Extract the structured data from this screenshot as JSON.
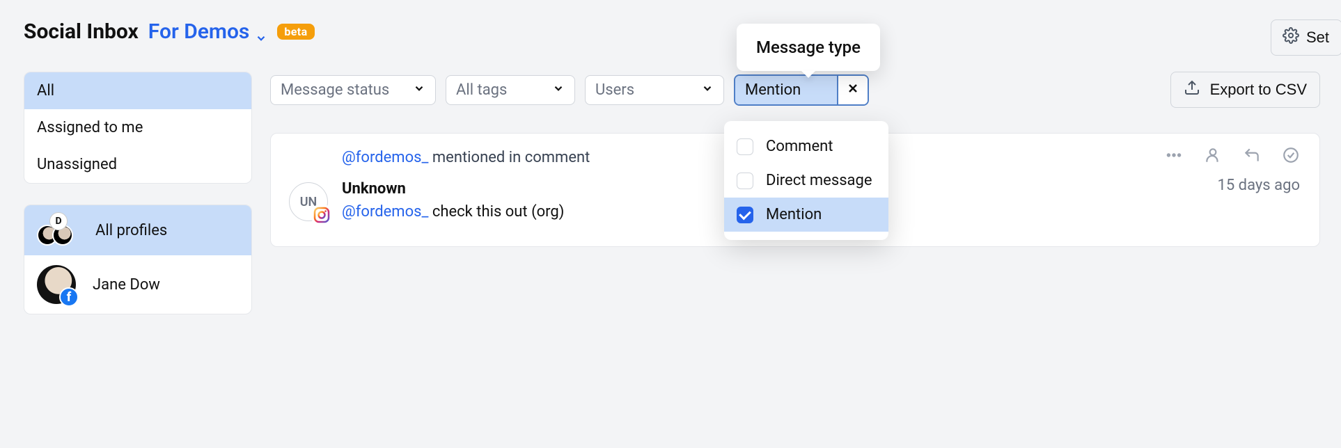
{
  "header": {
    "title": "Social Inbox",
    "workspace": "For Demos",
    "badge": "beta",
    "settings_label": "Set"
  },
  "tooltip": {
    "message_type": "Message type"
  },
  "sidebar": {
    "filters": [
      {
        "label": "All",
        "active": true
      },
      {
        "label": "Assigned to me",
        "active": false
      },
      {
        "label": "Unassigned",
        "active": false
      }
    ],
    "profiles_all_label": "All profiles",
    "profiles_all_badge": "D",
    "profiles": [
      {
        "name": "Jane Dow",
        "network": "facebook"
      }
    ]
  },
  "filters": {
    "status_label": "Message status",
    "tags_label": "All tags",
    "users_label": "Users",
    "mention_selected": "Mention",
    "export_label": "Export to CSV",
    "type_options": [
      {
        "label": "Comment",
        "checked": false
      },
      {
        "label": "Direct message",
        "checked": false
      },
      {
        "label": "Mention",
        "checked": true
      }
    ]
  },
  "message": {
    "handle": "@fordemos_",
    "context_suffix": " mentioned in comment",
    "avatar_initials": "UN",
    "author": "Unknown",
    "body_suffix": " check this out (org)",
    "timestamp": "15 days ago"
  }
}
